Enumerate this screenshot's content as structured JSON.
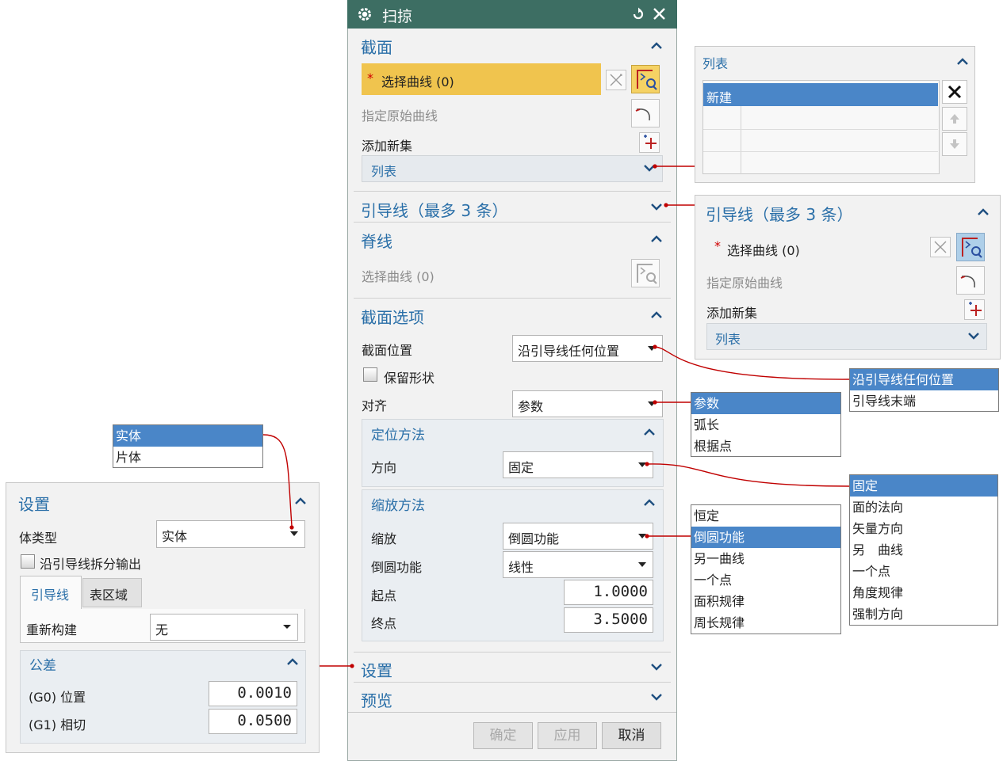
{
  "main": {
    "title": "扫掠",
    "section": {
      "title": "截面",
      "select_curve": "选择曲线 (0)",
      "specify_original": "指定原始曲线",
      "add_new_set": "添加新集",
      "list_label": "列表"
    },
    "guide": {
      "title": "引导线（最多 3 条）"
    },
    "spine": {
      "title": "脊线",
      "select_curve": "选择曲线 (0)"
    },
    "options": {
      "title": "截面选项",
      "position_label": "截面位置",
      "position_value": "沿引导线任何位置",
      "keep_shape": "保留形状",
      "align_label": "对齐",
      "align_value": "参数",
      "orient": {
        "title": "定位方法",
        "direction_label": "方向",
        "direction_value": "固定"
      },
      "scale": {
        "title": "缩放方法",
        "scale_label": "缩放",
        "scale_value": "倒圆功能",
        "blend_label": "倒圆功能",
        "blend_value": "线性",
        "start_label": "起点",
        "start_value": "1.0000",
        "end_label": "终点",
        "end_value": "3.5000"
      }
    },
    "settings_title": "设置",
    "preview_title": "预览",
    "buttons": {
      "ok": "确定",
      "apply": "应用",
      "cancel": "取消"
    }
  },
  "list_panel": {
    "title": "列表",
    "row1": "新建"
  },
  "guide_panel": {
    "title": "引导线（最多 3 条）",
    "select_curve": "选择曲线 (0)",
    "specify_original": "指定原始曲线",
    "add_new_set": "添加新集",
    "list_label": "列表"
  },
  "popups": {
    "position": [
      "沿引导线任何位置",
      "引导线末端"
    ],
    "align": [
      "参数",
      "弧长",
      "根据点"
    ],
    "direction": [
      "固定",
      "面的法向",
      "矢量方向",
      "另　曲线",
      "一个点",
      "角度规律",
      "强制方向"
    ],
    "scale": [
      "恒定",
      "倒圆功能",
      "另一曲线",
      "一个点",
      "面积规律",
      "周长规律"
    ],
    "body": [
      "实体",
      "片体"
    ]
  },
  "settings_panel": {
    "title": "设置",
    "body_type_label": "体类型",
    "body_type_value": "实体",
    "split_output": "沿引导线拆分输出",
    "tabs": [
      "引导线",
      "表区域"
    ],
    "rebuild_label": "重新构建",
    "rebuild_value": "无",
    "tolerance": {
      "title": "公差",
      "g0_label": "(G0) 位置",
      "g0_value": "0.0010",
      "g1_label": "(G1) 相切",
      "g1_value": "0.0500"
    }
  },
  "colors": {
    "title_bar": "#3d6e63",
    "accent_text": "#2a6fa8",
    "selection": "#f5d264",
    "highlight": "#4a86c8",
    "connector": "#c00000",
    "required": "#d00000"
  }
}
